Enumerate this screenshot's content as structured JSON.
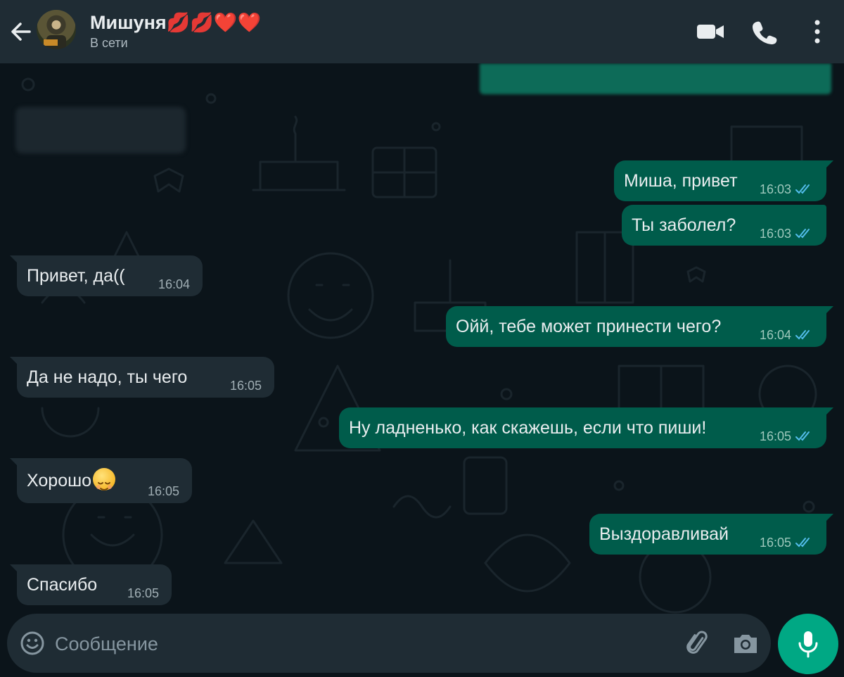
{
  "header": {
    "back_icon": "arrow-left-icon",
    "contact_name": "Мишуня💋💋❤️❤️",
    "status": "В сети",
    "icons": [
      "video-call-icon",
      "phone-call-icon",
      "more-vertical-icon"
    ]
  },
  "messages": [
    {
      "direction": "out",
      "text": "Миша, привет",
      "time": "16:03",
      "read": true
    },
    {
      "direction": "out",
      "text": "Ты заболел?",
      "time": "16:03",
      "read": true
    },
    {
      "direction": "in",
      "text": "Привет, да((",
      "time": "16:04"
    },
    {
      "direction": "out",
      "text": "Ойй, тебе может принести чего?",
      "time": "16:04",
      "read": true
    },
    {
      "direction": "in",
      "text": "Да не надо, ты чего",
      "time": "16:05"
    },
    {
      "direction": "out",
      "text": "Ну ладненько, как скажешь, если что пиши!",
      "time": "16:05",
      "read": true
    },
    {
      "direction": "in",
      "text": "Хорошо",
      "emoji": "relieved-face-emoji",
      "time": "16:05"
    },
    {
      "direction": "out",
      "text": "Выздоравливай",
      "time": "16:05",
      "read": true
    },
    {
      "direction": "in",
      "text": "Спасибо",
      "time": "16:05"
    }
  ],
  "composer": {
    "placeholder": "Сообщение",
    "icons": [
      "emoji-icon",
      "attach-paperclip-icon",
      "camera-icon",
      "microphone-icon"
    ]
  },
  "colors": {
    "background": "#0b141a",
    "header": "#1f2c34",
    "incoming_bubble": "#1f2c34",
    "outgoing_bubble": "#005c4b",
    "read_ticks": "#53bdeb",
    "accent": "#00a884"
  }
}
